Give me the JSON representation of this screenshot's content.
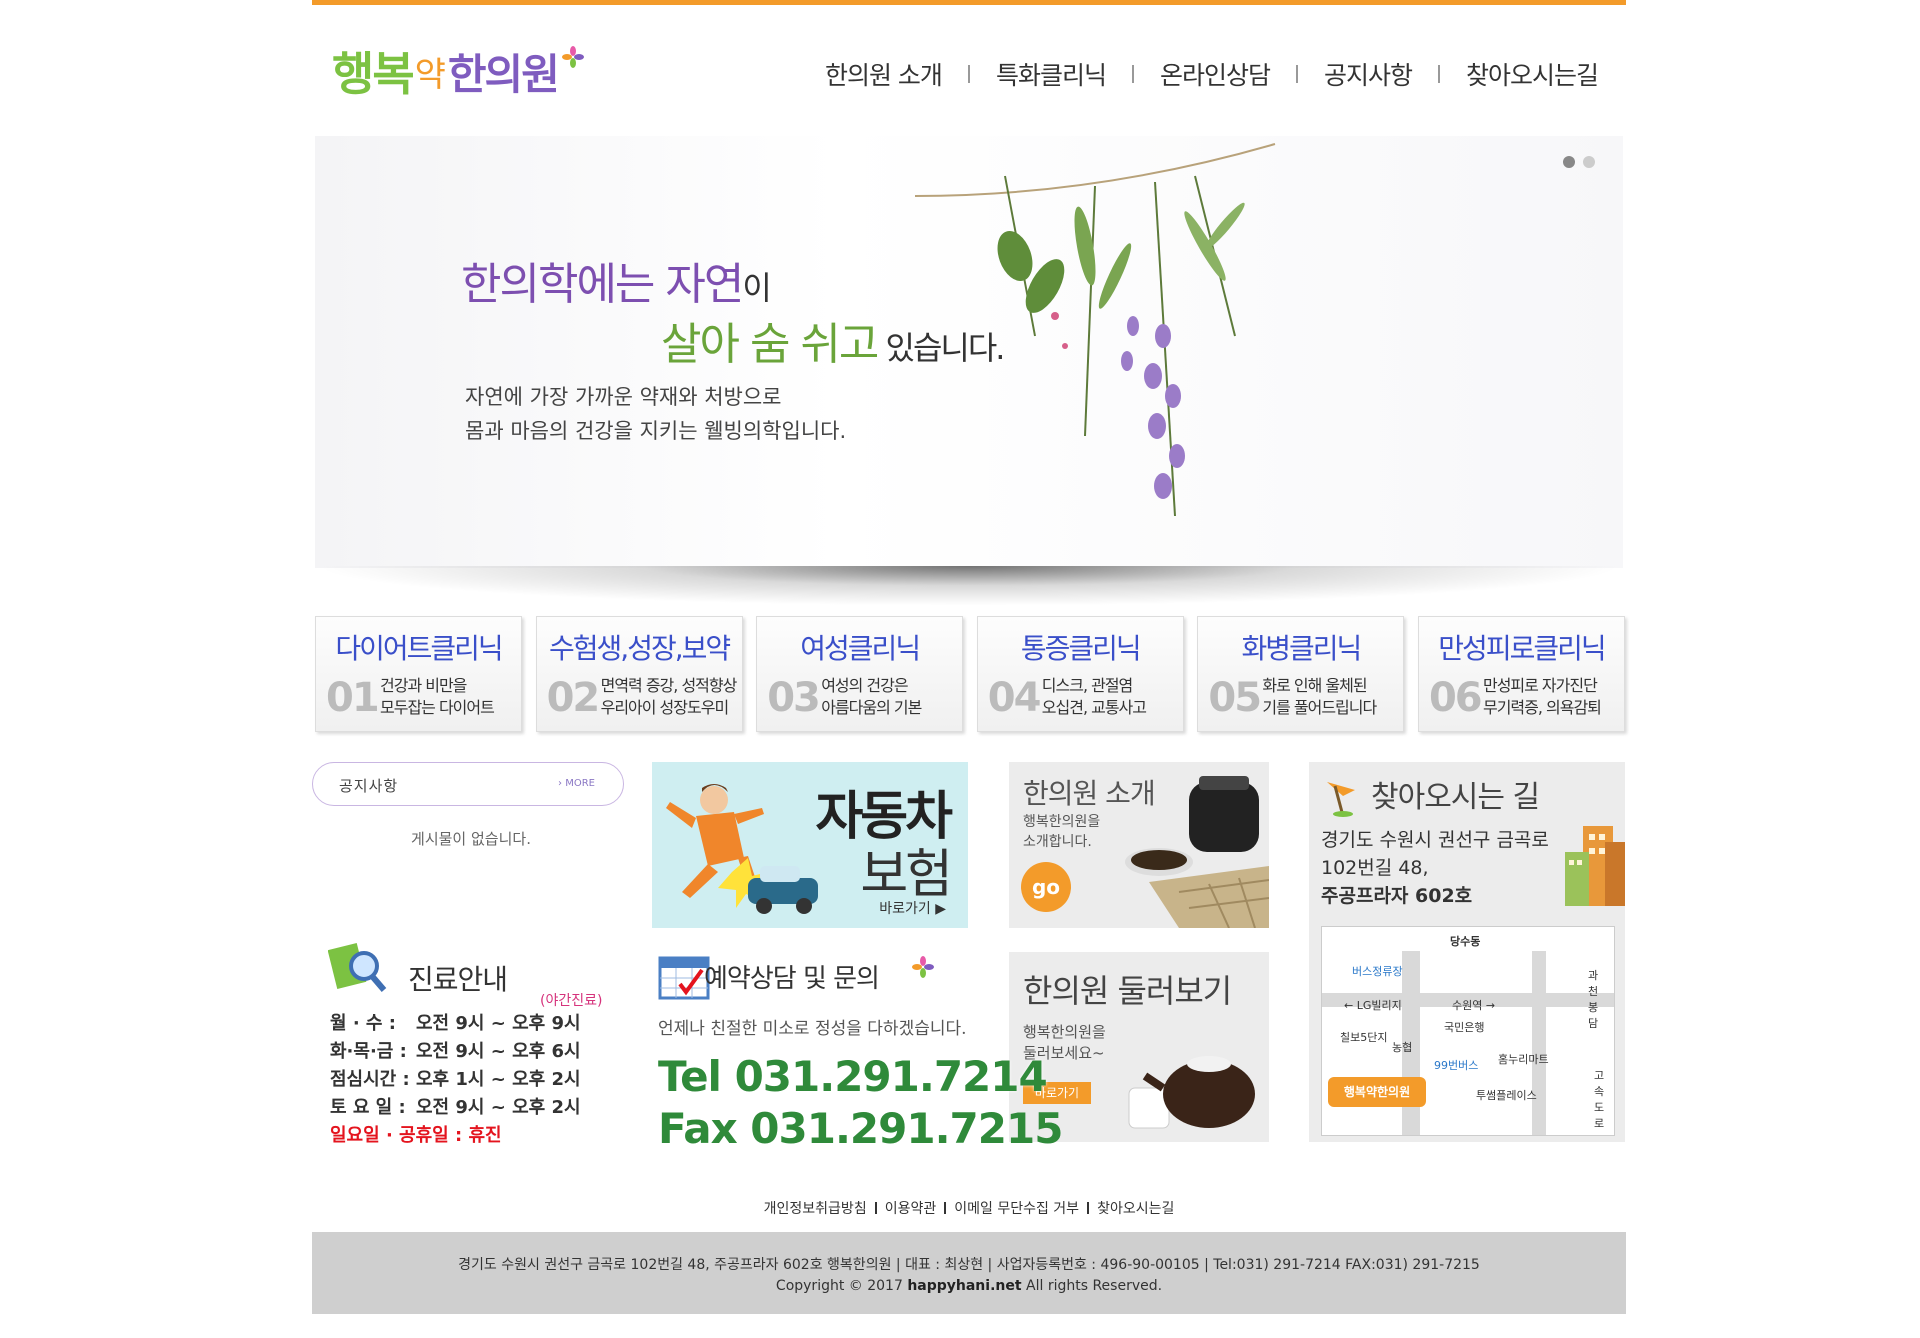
{
  "header": {
    "logo": {
      "part1": "행복",
      "part2": "약",
      "part3": "한의원"
    },
    "nav": [
      "한의원 소개",
      "특화클리닉",
      "온라인상담",
      "공지사항",
      "찾아오시는길"
    ]
  },
  "hero": {
    "line1_a": "한의학에는 자연",
    "line1_b": "이",
    "line2_a": "살아 숨 쉬고",
    "line2_b": " 있습니다.",
    "desc1": "자연에 가장 가까운 약재와 처방으로",
    "desc2": "몸과 마음의 건강을 지키는 웰빙의학입니다.",
    "slides": 2,
    "active_slide": 1
  },
  "clinics": [
    {
      "title": "다이어트클리닉",
      "num": "01",
      "l1": "건강과 비만을",
      "l2": "모두잡는 다이어트"
    },
    {
      "title": "수험생,성장,보약",
      "num": "02",
      "l1": "면역력 증강, 성적향상",
      "l2": "우리아이 성장도우미"
    },
    {
      "title": "여성클리닉",
      "num": "03",
      "l1": "여성의 건강은",
      "l2": "아름다움의 기본"
    },
    {
      "title": "통증클리닉",
      "num": "04",
      "l1": "디스크, 관절염",
      "l2": "오십견, 교통사고"
    },
    {
      "title": "화병클리닉",
      "num": "05",
      "l1": "화로 인해 울체된",
      "l2": "기를 풀어드립니다"
    },
    {
      "title": "만성피로클리닉",
      "num": "06",
      "l1": "만성피로 자가진단",
      "l2": "무기력증, 의욕감퇴"
    }
  ],
  "notice": {
    "title": "공지사항",
    "more": "MORE",
    "empty": "게시물이 없습니다."
  },
  "car_banner": {
    "t1": "자동차",
    "t2": "보험",
    "go": "바로가기 ▶"
  },
  "intro_banner": {
    "title": "한의원 소개",
    "l1": "행복한의원을",
    "l2": "소개합니다.",
    "go": "go"
  },
  "tour_banner": {
    "title": "한의원 둘러보기",
    "l1": "행복한의원을",
    "l2": "둘러보세요~",
    "btn": "바로가기"
  },
  "location": {
    "title": "찾아오시는 길",
    "addr1": "경기도 수원시 권선구 금곡로",
    "addr2": "102번길 48,",
    "addr3": "주공프라자 602호",
    "map": {
      "top": "당수동",
      "bus_stop": "버스정류장",
      "lg": "LG빌리지",
      "suwon": "수원역",
      "right": "과천 봉담",
      "bank": "국민은행",
      "chilbo": "칠보5단지",
      "nh": "농협",
      "homeplus": "홈누리마트",
      "bus": "99번버스",
      "twosome": "투썸플레이스",
      "highway": "고속도로",
      "logo": "행복약한의원"
    }
  },
  "hours": {
    "title": "진료안내",
    "night": "(야간진료)",
    "rows": [
      {
        "k": "월 · 수 :",
        "v": "오전 9시 ~ 오후 9시"
      },
      {
        "k": "화·목·금 :",
        "v": "오전 9시 ~ 오후 6시"
      },
      {
        "k": "점심시간 :",
        "v": "오후 1시 ~ 오후 2시"
      },
      {
        "k": "토 요 일 :",
        "v": "오전 9시 ~ 오후 2시"
      }
    ],
    "holiday": "일요일 · 공휴일 : 휴진"
  },
  "reservation": {
    "title": "예약상담 및 문의",
    "sub": "언제나 친절한 미소로 정성을 다하겠습니다.",
    "tel": "Tel  031.291.7214",
    "fax": "Fax 031.291.7215"
  },
  "footer": {
    "links": [
      "개인정보취급방침",
      "이용약관",
      "이메일 무단수집 거부",
      "찾아오시는길"
    ],
    "info": "경기도 수원시 권선구 금곡로 102번길 48, 주공프라자 602호 행복한의원 | 대표 : 최상현 | 사업자등록번호 : 496-90-00105 | Tel:031) 291-7214  FAX:031) 291-7215",
    "copy_pre": "Copyright © 2017 ",
    "copy_site": "happyhani.net",
    "copy_post": " All rights Reserved."
  },
  "colors": {
    "accent": "#f39b2a",
    "purple": "#7d4fb0",
    "green": "#6aa43a",
    "clinic_blue": "#3a4fc9",
    "tel_green": "#2f8a3a"
  }
}
